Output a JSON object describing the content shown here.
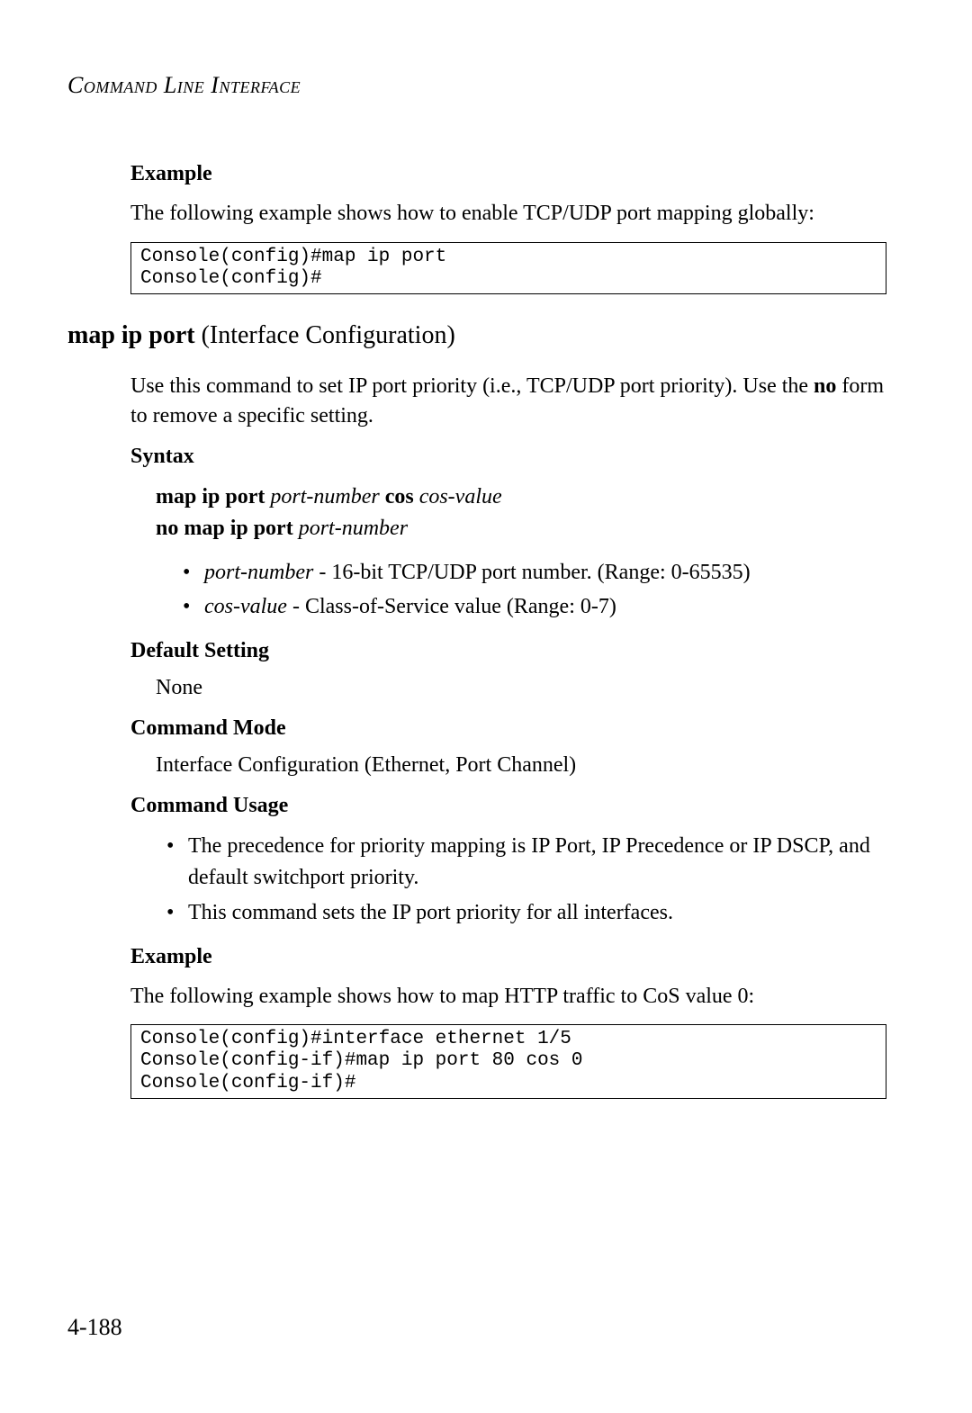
{
  "header": "Command Line Interface",
  "sec1": {
    "example_head": "Example",
    "example_text": "The following example shows how to enable TCP/UDP port mapping globally:",
    "code": "Console(config)#map ip port\nConsole(config)#"
  },
  "title": {
    "bold": "map ip port",
    "rest": " (Interface Configuration)"
  },
  "intro_a": "Use this command to set IP port priority (i.e., TCP/UDP port priority). Use the ",
  "intro_no": "no",
  "intro_b": " form to remove a specific setting.",
  "syntax": {
    "head": "Syntax",
    "l1_a": "map ip port",
    "l1_b": "port-number",
    "l1_c": "cos",
    "l1_d": "cos-value",
    "l2_a": "no map ip port",
    "l2_b": "port-number",
    "b1_i": "port-number",
    "b1_t": " - 16-bit TCP/UDP port number. (Range: 0-65535)",
    "b2_i": "cos-value",
    "b2_t": " - Class-of-Service value (Range: 0-7)"
  },
  "default": {
    "head": "Default Setting",
    "val": "None"
  },
  "mode": {
    "head": "Command Mode",
    "val": "Interface Configuration (Ethernet, Port Channel)"
  },
  "usage": {
    "head": "Command Usage",
    "b1": "The precedence for priority mapping is IP Port, IP Precedence or IP DSCP, and default switchport priority.",
    "b2": "This command sets the IP port priority for all interfaces."
  },
  "ex2": {
    "head": "Example",
    "text": "The following example shows how to map HTTP traffic to CoS value 0:",
    "code": "Console(config)#interface ethernet 1/5\nConsole(config-if)#map ip port 80 cos 0\nConsole(config-if)#"
  },
  "pagenum": "4-188"
}
